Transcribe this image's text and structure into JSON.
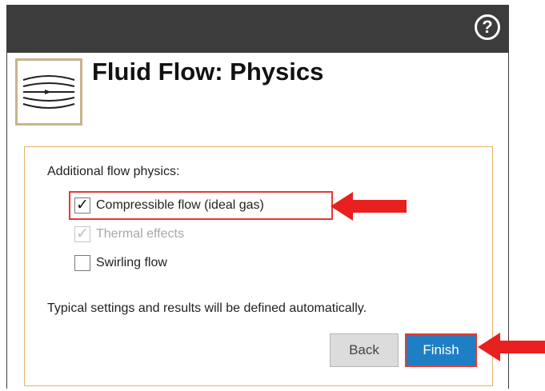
{
  "dialog": {
    "title": "Fluid Flow: Physics",
    "help_icon": "help-icon",
    "header_icon": "fluid-flow-icon"
  },
  "panel": {
    "section_label": "Additional flow physics:",
    "options": [
      {
        "label": "Compressible flow (ideal gas)",
        "checked": true,
        "enabled": true
      },
      {
        "label": "Thermal effects",
        "checked": true,
        "enabled": false
      },
      {
        "label": "Swirling flow",
        "checked": false,
        "enabled": true
      }
    ],
    "note": "Typical settings and results will be defined automatically."
  },
  "buttons": {
    "back": "Back",
    "finish": "Finish"
  },
  "colors": {
    "titlebar": "#3c3c3c",
    "accent": "#1f7fc4",
    "highlight": "#e53935",
    "panel_border": "#e6b266"
  }
}
